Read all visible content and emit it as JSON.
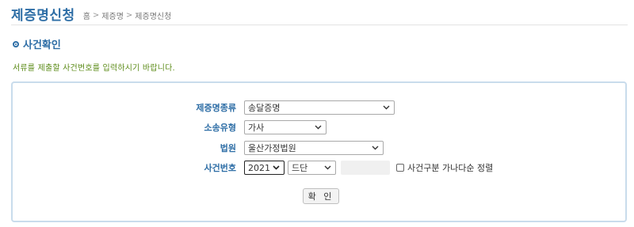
{
  "header": {
    "title": "제증명신청",
    "breadcrumb": [
      "홈",
      "제증명",
      "제증명신청"
    ],
    "separator": ">"
  },
  "section": {
    "title": "사건확인",
    "instruction": "서류를 제출할 사건번호를 입력하시기 바랍니다."
  },
  "form": {
    "cert_type": {
      "label": "제증명종류",
      "value": "송달증명"
    },
    "case_type": {
      "label": "소송유형",
      "value": "가사"
    },
    "court": {
      "label": "법원",
      "value": "울산가정법원"
    },
    "case_number": {
      "label": "사건번호",
      "year": "2021",
      "code": "드단",
      "number": ""
    },
    "sort_checkbox": {
      "label": "사건구분 가나다순 정렬",
      "checked": false
    },
    "confirm_button": "확 인"
  },
  "colors": {
    "accent": "#2e6ea6",
    "instruction": "#5d8c1a",
    "box_border": "#c9dcec"
  }
}
